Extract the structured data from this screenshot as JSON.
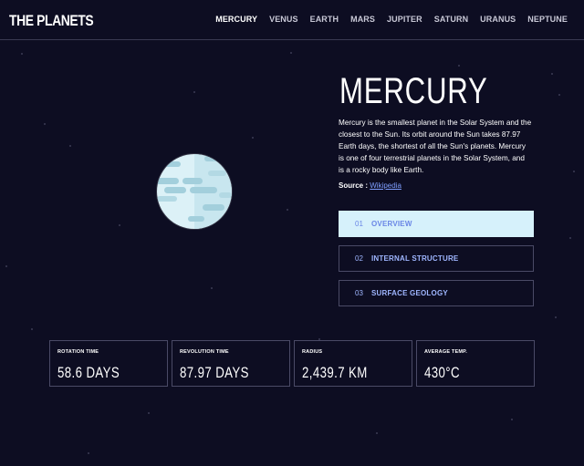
{
  "header": {
    "logo": "THE PLANETS",
    "nav": [
      "MERCURY",
      "VENUS",
      "EARTH",
      "MARS",
      "JUPITER",
      "SATURN",
      "URANUS",
      "NEPTUNE"
    ],
    "active_nav": "MERCURY"
  },
  "planet": {
    "name": "MERCURY",
    "description": "Mercury is the smallest planet in the Solar System and the closest to the Sun. Its orbit around the Sun takes 87.97 Earth days, the shortest of all the Sun's planets. Mercury is one of four terrestrial planets in the Solar System, and is a rocky body like Earth.",
    "source_label": "Source : ",
    "source_link": "Wikipedia"
  },
  "tabs": [
    {
      "num": "01",
      "label": "OVERVIEW",
      "active": true
    },
    {
      "num": "02",
      "label": "INTERNAL STRUCTURE",
      "active": false
    },
    {
      "num": "03",
      "label": "SURFACE GEOLOGY",
      "active": false
    }
  ],
  "stats": [
    {
      "label": "ROTATION TIME",
      "value": "58.6 DAYS"
    },
    {
      "label": "REVOLUTION TIME",
      "value": "87.97 DAYS"
    },
    {
      "label": "RADIUS",
      "value": "2,439.7 KM"
    },
    {
      "label": "AVERAGE TEMP.",
      "value": "430°C"
    }
  ],
  "colors": {
    "background": "#0d0d22",
    "active_tab_bg": "#d6f1fb",
    "accent_text": "#9fb6ff",
    "border": "#4a4a66"
  }
}
